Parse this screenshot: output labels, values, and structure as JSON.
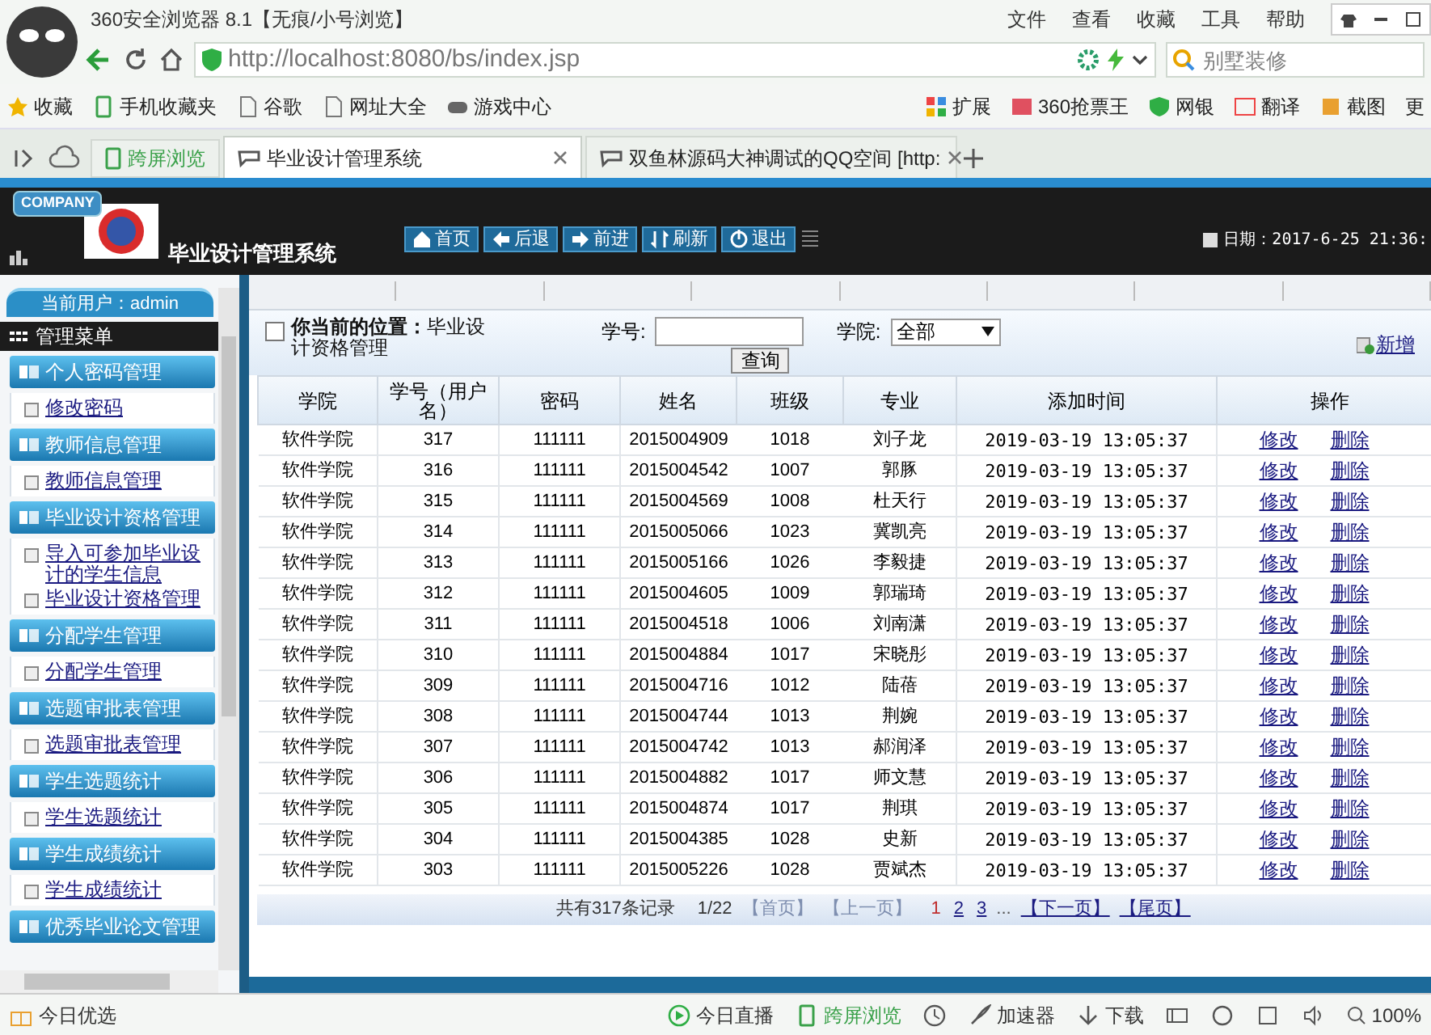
{
  "browser": {
    "title": "360安全浏览器 8.1【无痕/小号浏览】",
    "menu": [
      "文件",
      "查看",
      "收藏",
      "工具",
      "帮助"
    ],
    "url": "http://localhost:8080/bs/index.jsp",
    "search": {
      "placeholder": "别墅装修"
    },
    "bookmarks_left": [
      "收藏",
      "手机收藏夹",
      "谷歌",
      "网址大全",
      "游戏中心"
    ],
    "bookmarks_right": [
      "扩展",
      "360抢票王",
      "网银",
      "翻译",
      "截图",
      "更"
    ],
    "tabs": [
      {
        "label": "跨屏浏览",
        "kind": "pinned",
        "selected": false
      },
      {
        "label": "毕业设计管理系统",
        "kind": "page",
        "selected": true
      },
      {
        "label": "双鱼林源码大神调试的QQ空间 [http:",
        "kind": "page",
        "selected": false
      }
    ]
  },
  "app": {
    "company": "COMPANY",
    "title": "毕业设计管理系统",
    "nav": [
      "首页",
      "后退",
      "前进",
      "刷新",
      "退出"
    ],
    "date": "日期：2017-6-25 21:36:"
  },
  "sidebar": {
    "current_user": "当前用户：admin",
    "menu_title": "管理菜单",
    "groups": [
      {
        "title": "个人密码管理",
        "items": [
          "修改密码"
        ]
      },
      {
        "title": "教师信息管理",
        "items": [
          "教师信息管理"
        ]
      },
      {
        "title": "毕业设计资格管理",
        "items": [
          "导入可参加毕业设计的学生信息",
          "毕业设计资格管理"
        ]
      },
      {
        "title": "分配学生管理",
        "items": [
          "分配学生管理"
        ]
      },
      {
        "title": "选题审批表管理",
        "items": [
          "选题审批表管理"
        ]
      },
      {
        "title": "学生选题统计",
        "items": [
          "学生选题统计"
        ]
      },
      {
        "title": "学生成绩统计",
        "items": [
          "学生成绩统计"
        ]
      },
      {
        "title": "优秀毕业论文管理"
      }
    ]
  },
  "content": {
    "breadcrumb": "**你当前的位置：**毕业设计资格管理",
    "filters": {
      "id_label": "学号:",
      "college_label": "学院:",
      "college_value": "全部",
      "query": "查询"
    },
    "add": "新增",
    "table": {
      "columns": [
        "学院",
        "学号（用户名）",
        "密码",
        "姓名",
        "班级",
        "专业",
        "添加时间",
        "操作"
      ],
      "rows": [
        {
          "cells": [
            "软件学院",
            "317",
            "111111",
            "2015004909",
            "1018",
            "刘子龙",
            "2019-03-19 13:05:37"
          ],
          "actions": [
            "修改",
            "删除"
          ]
        },
        {
          "cells": [
            "软件学院",
            "316",
            "111111",
            "2015004542",
            "1007",
            "郭豚",
            "2019-03-19 13:05:37"
          ],
          "actions": [
            "修改",
            "删除"
          ]
        },
        {
          "cells": [
            "软件学院",
            "315",
            "111111",
            "2015004569",
            "1008",
            "杜天行",
            "2019-03-19 13:05:37"
          ],
          "actions": [
            "修改",
            "删除"
          ]
        },
        {
          "cells": [
            "软件学院",
            "314",
            "111111",
            "2015005066",
            "1023",
            "冀凯亮",
            "2019-03-19 13:05:37"
          ],
          "actions": [
            "修改",
            "删除"
          ]
        },
        {
          "cells": [
            "软件学院",
            "313",
            "111111",
            "2015005166",
            "1026",
            "李毅捷",
            "2019-03-19 13:05:37"
          ],
          "actions": [
            "修改",
            "删除"
          ]
        },
        {
          "cells": [
            "软件学院",
            "312",
            "111111",
            "2015004605",
            "1009",
            "郭瑞琦",
            "2019-03-19 13:05:37"
          ],
          "actions": [
            "修改",
            "删除"
          ]
        },
        {
          "cells": [
            "软件学院",
            "311",
            "111111",
            "2015004518",
            "1006",
            "刘南潇",
            "2019-03-19 13:05:37"
          ],
          "actions": [
            "修改",
            "删除"
          ]
        },
        {
          "cells": [
            "软件学院",
            "310",
            "111111",
            "2015004884",
            "1017",
            "宋晓彤",
            "2019-03-19 13:05:37"
          ],
          "actions": [
            "修改",
            "删除"
          ]
        },
        {
          "cells": [
            "软件学院",
            "309",
            "111111",
            "2015004716",
            "1012",
            "陆蓓",
            "2019-03-19 13:05:37"
          ],
          "actions": [
            "修改",
            "删除"
          ]
        },
        {
          "cells": [
            "软件学院",
            "308",
            "111111",
            "2015004744",
            "1013",
            "荆婉",
            "2019-03-19 13:05:37"
          ],
          "actions": [
            "修改",
            "删除"
          ]
        },
        {
          "cells": [
            "软件学院",
            "307",
            "111111",
            "2015004742",
            "1013",
            "郝润泽",
            "2019-03-19 13:05:37"
          ],
          "actions": [
            "修改",
            "删除"
          ]
        },
        {
          "cells": [
            "软件学院",
            "306",
            "111111",
            "2015004882",
            "1017",
            "师文慧",
            "2019-03-19 13:05:37"
          ],
          "actions": [
            "修改",
            "删除"
          ]
        },
        {
          "cells": [
            "软件学院",
            "305",
            "111111",
            "2015004874",
            "1017",
            "荆琪",
            "2019-03-19 13:05:37"
          ],
          "actions": [
            "修改",
            "删除"
          ]
        },
        {
          "cells": [
            "软件学院",
            "304",
            "111111",
            "2015004385",
            "1028",
            "史新",
            "2019-03-19 13:05:37"
          ],
          "actions": [
            "修改",
            "删除"
          ]
        },
        {
          "cells": [
            "软件学院",
            "303",
            "111111",
            "2015005226",
            "1028",
            "贾斌杰",
            "2019-03-19 13:05:37"
          ],
          "actions": [
            "修改",
            "删除"
          ]
        }
      ]
    },
    "pagination": {
      "summary": "共有317条记录",
      "page": "1/22",
      "first": {
        "label": "【首页】",
        "disabled": true
      },
      "prev": {
        "label": "【上一页】",
        "disabled": true
      },
      "pages": [
        {
          "label": "1",
          "selected": true
        },
        {
          "label": "2",
          "selected": false
        },
        {
          "label": "3",
          "selected": false
        }
      ],
      "ellipsis": "...",
      "next": {
        "label": "【下一页】",
        "disabled": false
      },
      "last": {
        "label": "【尾页】",
        "disabled": false
      }
    }
  },
  "status_bar": {
    "left": "今日优选",
    "items": [
      "今日直播",
      "跨屏浏览",
      "加速器",
      "下载"
    ],
    "zoom": "100%"
  }
}
